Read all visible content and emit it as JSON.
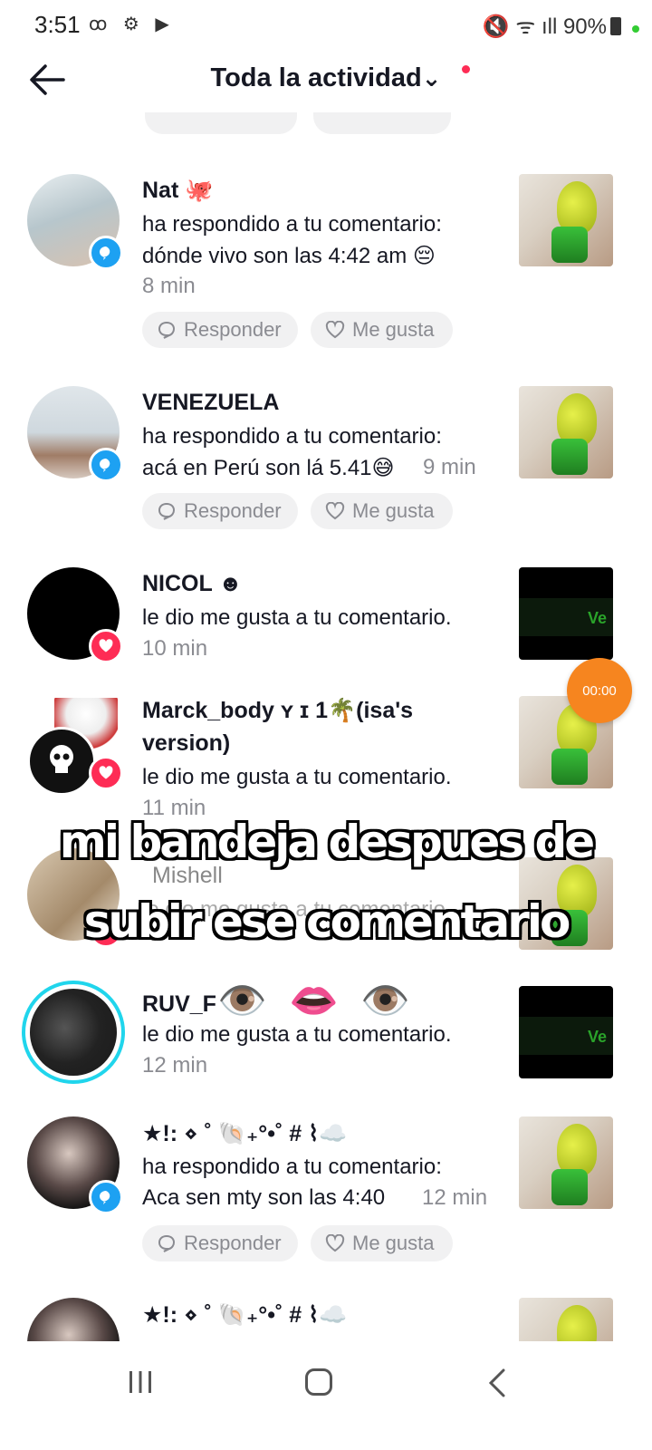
{
  "status_bar": {
    "time": "3:51",
    "left_icons": "ꝏ ⚙ ▶",
    "battery": "90%",
    "right_icons": "🔇 ᯤ ıll"
  },
  "header": {
    "title": "Toda la actividad",
    "chevron": "⌄"
  },
  "colors": {
    "reply_badge": "#1da1f2",
    "like_badge": "#fe2c55",
    "timer": "#f6851f"
  },
  "notifications": [
    {
      "name": "Nat 🐙",
      "action": "ha respondido a tu comentario:",
      "text": "dónde vivo son las 4:42 am 😔",
      "time": "8 min",
      "badge": "reply-icon",
      "reply_label": "Responder",
      "like_label": "Me gusta"
    },
    {
      "name": "VENEZUELA",
      "action": "ha respondido a tu comentario:",
      "text": "acá en Perú son lá 5.41😅",
      "time": "9 min",
      "badge": "reply-icon",
      "reply_label": "Responder",
      "like_label": "Me gusta"
    },
    {
      "name": "NICOL ☻",
      "action": "le dio me gusta a tu comentario.",
      "time": "10 min",
      "badge": "heart-icon"
    },
    {
      "name_line1": "Marck_body ʏ ɪ 1🌴(isa's",
      "name_line2": "version)",
      "action": "le dio me gusta a tu comentario.",
      "time": "11 min",
      "badge": "heart-icon"
    },
    {
      "name": "Mishell",
      "action": "le dio me gusta a tu comentario.",
      "badge": "heart-icon"
    },
    {
      "name": "RUV_F",
      "emoji": "👁️ 👄 👁️",
      "action": "le dio me gusta a tu comentario.",
      "time": "12 min"
    },
    {
      "name": "★!: ⋄ ˚ 🐚₊°•˚ # ⌇☁️",
      "action": "ha respondido a tu comentario:",
      "text": "Aca sen mty son las 4:40",
      "time": "12 min",
      "badge": "reply-icon",
      "reply_label": "Responder",
      "like_label": "Me gusta"
    },
    {
      "name": "★!: ⋄ ˚ 🐚₊°•˚ # ⌇☁️"
    }
  ],
  "thumb_dark_text": "Ve",
  "timer": "00:00",
  "caption": {
    "line1": "mi bandeja despues de",
    "line2": "subir ese comentario"
  }
}
